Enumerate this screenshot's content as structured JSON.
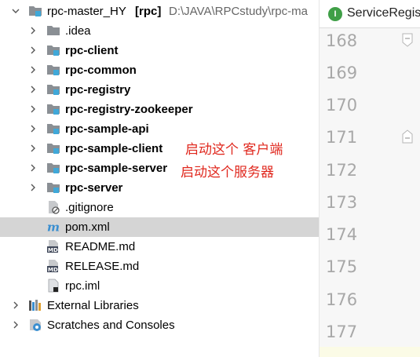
{
  "tree": {
    "root": {
      "name": "rpc-master_HY",
      "module": "[rpc]",
      "path": "D:\\JAVA\\RPCstudy\\rpc-ma"
    },
    "items": [
      {
        "label": ".idea",
        "bold": false
      },
      {
        "label": "rpc-client",
        "bold": true
      },
      {
        "label": "rpc-common",
        "bold": true
      },
      {
        "label": "rpc-registry",
        "bold": true
      },
      {
        "label": "rpc-registry-zookeeper",
        "bold": true
      },
      {
        "label": "rpc-sample-api",
        "bold": true
      },
      {
        "label": "rpc-sample-client",
        "bold": true
      },
      {
        "label": "rpc-sample-server",
        "bold": true
      },
      {
        "label": "rpc-server",
        "bold": true
      },
      {
        "label": ".gitignore",
        "bold": false
      },
      {
        "label": "pom.xml",
        "bold": false
      },
      {
        "label": "README.md",
        "bold": false
      },
      {
        "label": "RELEASE.md",
        "bold": false
      },
      {
        "label": "rpc.iml",
        "bold": false
      }
    ],
    "external_libraries": "External Libraries",
    "scratches": "Scratches and Consoles"
  },
  "annotations": {
    "client_note": "启动这个 客户端",
    "server_note": "启动这个服务器"
  },
  "editor": {
    "tab_label": "ServiceRegis",
    "tab_icon_letter": "I",
    "line_numbers": [
      "168",
      "169",
      "170",
      "171",
      "172",
      "173",
      "174",
      "175",
      "176",
      "177"
    ]
  },
  "colors": {
    "folder_blue": "#40a8d8",
    "folder_gray": "#8a8f94",
    "annotation_red": "#e0281e",
    "selection": "#d5d5d5",
    "interface_icon": "#3f9f47"
  }
}
